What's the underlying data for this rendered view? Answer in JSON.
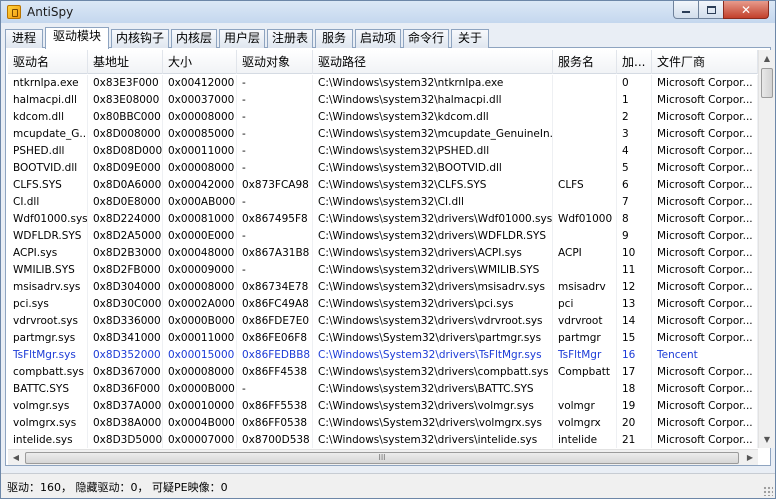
{
  "window": {
    "title": "AntiSpy",
    "minimize_label": "",
    "maximize_label": "",
    "close_label": "✕"
  },
  "tabs": [
    {
      "label": "进程"
    },
    {
      "label": "驱动模块"
    },
    {
      "label": "内核钩子"
    },
    {
      "label": "内核层"
    },
    {
      "label": "用户层"
    },
    {
      "label": "注册表"
    },
    {
      "label": "服务"
    },
    {
      "label": "启动项"
    },
    {
      "label": "命令行"
    },
    {
      "label": "关于"
    }
  ],
  "active_tab": "驱动模块",
  "table": {
    "columns": [
      "驱动名",
      "基地址",
      "大小",
      "驱动对象",
      "驱动路径",
      "服务名",
      "加...",
      "文件厂商"
    ],
    "highlight_color": "#1c3bd6",
    "rows": [
      [
        "ntkrnlpa.exe",
        "0x83E3F000",
        "0x00412000",
        "-",
        "C:\\Windows\\system32\\ntkrnlpa.exe",
        "",
        "0",
        "Microsoft Corpor..."
      ],
      [
        "halmacpi.dll",
        "0x83E08000",
        "0x00037000",
        "-",
        "C:\\Windows\\system32\\halmacpi.dll",
        "",
        "1",
        "Microsoft Corpor..."
      ],
      [
        "kdcom.dll",
        "0x80BBC000",
        "0x00008000",
        "-",
        "C:\\Windows\\system32\\kdcom.dll",
        "",
        "2",
        "Microsoft Corpor..."
      ],
      [
        "mcupdate_G...",
        "0x8D008000",
        "0x00085000",
        "-",
        "C:\\Windows\\system32\\mcupdate_GenuineIn...",
        "",
        "3",
        "Microsoft Corpor..."
      ],
      [
        "PSHED.dll",
        "0x8D08D000",
        "0x00011000",
        "-",
        "C:\\Windows\\system32\\PSHED.dll",
        "",
        "4",
        "Microsoft Corpor..."
      ],
      [
        "BOOTVID.dll",
        "0x8D09E000",
        "0x00008000",
        "-",
        "C:\\Windows\\system32\\BOOTVID.dll",
        "",
        "5",
        "Microsoft Corpor..."
      ],
      [
        "CLFS.SYS",
        "0x8D0A6000",
        "0x00042000",
        "0x873FCA98",
        "C:\\Windows\\system32\\CLFS.SYS",
        "CLFS",
        "6",
        "Microsoft Corpor..."
      ],
      [
        "CI.dll",
        "0x8D0E8000",
        "0x000AB000",
        "-",
        "C:\\Windows\\system32\\CI.dll",
        "",
        "7",
        "Microsoft Corpor..."
      ],
      [
        "Wdf01000.sys",
        "0x8D224000",
        "0x00081000",
        "0x867495F8",
        "C:\\Windows\\system32\\drivers\\Wdf01000.sys",
        "Wdf01000",
        "8",
        "Microsoft Corpor..."
      ],
      [
        "WDFLDR.SYS",
        "0x8D2A5000",
        "0x0000E000",
        "-",
        "C:\\Windows\\system32\\drivers\\WDFLDR.SYS",
        "",
        "9",
        "Microsoft Corpor..."
      ],
      [
        "ACPI.sys",
        "0x8D2B3000",
        "0x00048000",
        "0x867A31B8",
        "C:\\Windows\\system32\\drivers\\ACPI.sys",
        "ACPI",
        "10",
        "Microsoft Corpor..."
      ],
      [
        "WMILIB.SYS",
        "0x8D2FB000",
        "0x00009000",
        "-",
        "C:\\Windows\\system32\\drivers\\WMILIB.SYS",
        "",
        "11",
        "Microsoft Corpor..."
      ],
      [
        "msisadrv.sys",
        "0x8D304000",
        "0x00008000",
        "0x86734E78",
        "C:\\Windows\\system32\\drivers\\msisadrv.sys",
        "msisadrv",
        "12",
        "Microsoft Corpor..."
      ],
      [
        "pci.sys",
        "0x8D30C000",
        "0x0002A000",
        "0x86FC49A8",
        "C:\\Windows\\system32\\drivers\\pci.sys",
        "pci",
        "13",
        "Microsoft Corpor..."
      ],
      [
        "vdrvroot.sys",
        "0x8D336000",
        "0x0000B000",
        "0x86FDE7E0",
        "C:\\Windows\\system32\\drivers\\vdrvroot.sys",
        "vdrvroot",
        "14",
        "Microsoft Corpor..."
      ],
      [
        "partmgr.sys",
        "0x8D341000",
        "0x00011000",
        "0x86FE06F8",
        "C:\\Windows\\System32\\drivers\\partmgr.sys",
        "partmgr",
        "15",
        "Microsoft Corpor..."
      ],
      [
        "TsFltMgr.sys",
        "0x8D352000",
        "0x00015000",
        "0x86FEDBB8",
        "C:\\Windows\\System32\\drivers\\TsFltMgr.sys",
        "TsFltMgr",
        "16",
        "Tencent"
      ],
      [
        "compbatt.sys",
        "0x8D367000",
        "0x00008000",
        "0x86FF4538",
        "C:\\Windows\\system32\\drivers\\compbatt.sys",
        "Compbatt",
        "17",
        "Microsoft Corpor..."
      ],
      [
        "BATTC.SYS",
        "0x8D36F000",
        "0x0000B000",
        "-",
        "C:\\Windows\\system32\\drivers\\BATTC.SYS",
        "",
        "18",
        "Microsoft Corpor..."
      ],
      [
        "volmgr.sys",
        "0x8D37A000",
        "0x00010000",
        "0x86FF5538",
        "C:\\Windows\\system32\\drivers\\volmgr.sys",
        "volmgr",
        "19",
        "Microsoft Corpor..."
      ],
      [
        "volmgrx.sys",
        "0x8D38A000",
        "0x0004B000",
        "0x86FF0538",
        "C:\\Windows\\System32\\drivers\\volmgrx.sys",
        "volmgrx",
        "20",
        "Microsoft Corpor..."
      ],
      [
        "intelide.sys",
        "0x8D3D5000",
        "0x00007000",
        "0x8700D538",
        "C:\\Windows\\system32\\drivers\\intelide.sys",
        "intelide",
        "21",
        "Microsoft Corpor..."
      ]
    ],
    "highlighted_rows": [
      16
    ]
  },
  "scroll": {
    "hthumb_glyph": "III"
  },
  "status": {
    "text": "驱动：160， 隐藏驱动：0， 可疑PE映像：0"
  }
}
